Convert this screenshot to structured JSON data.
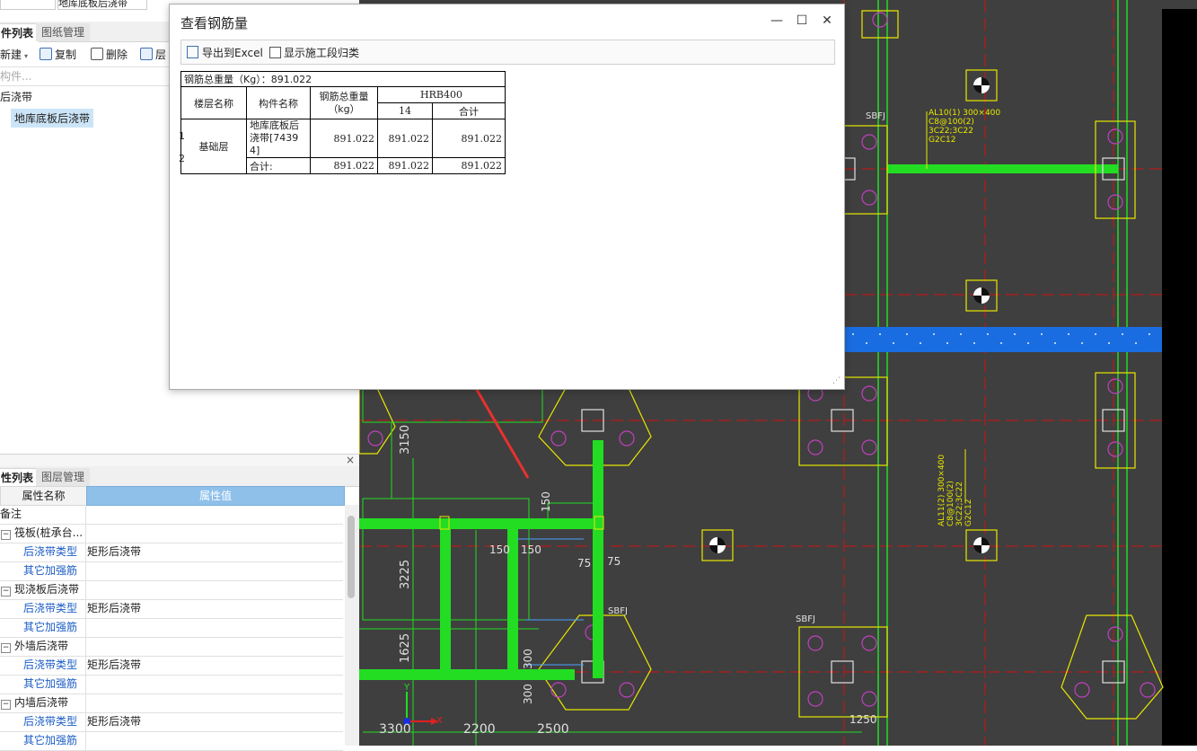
{
  "left_top": {
    "search_value": "地库底板后浇带",
    "tabs": [
      "件列表",
      "图纸管理"
    ],
    "toolbar": {
      "new": "新建",
      "copy": "复制",
      "delete": "删除",
      "layer": "层"
    },
    "search_placeholder": "构件...",
    "tree": {
      "group": "后浇带",
      "selected": "地库底板后浇带"
    }
  },
  "left_bottom": {
    "tabs": [
      "性列表",
      "图层管理"
    ],
    "close": "×",
    "header": {
      "name": "属性名称",
      "value": "属性值"
    },
    "rows": [
      {
        "name": "备注",
        "value": ""
      },
      {
        "name": "筏板(桩承台...",
        "value": "",
        "expander": "−"
      },
      {
        "name": "后浇带类型",
        "value": "矩形后浇带"
      },
      {
        "name": "其它加强筋",
        "value": ""
      },
      {
        "name": "现浇板后浇带",
        "value": "",
        "expander": "−"
      },
      {
        "name": "后浇带类型",
        "value": "矩形后浇带"
      },
      {
        "name": "其它加强筋",
        "value": ""
      },
      {
        "name": "外墙后浇带",
        "value": "",
        "expander": "−"
      },
      {
        "name": "后浇带类型",
        "value": "矩形后浇带"
      },
      {
        "name": "其它加强筋",
        "value": ""
      },
      {
        "name": "内墙后浇带",
        "value": "",
        "expander": "−"
      },
      {
        "name": "后浇带类型",
        "value": "矩形后浇带"
      },
      {
        "name": "其它加强筋",
        "value": ""
      }
    ]
  },
  "dialog": {
    "title": "查看钢筋量",
    "buttons": {
      "minimize": "—",
      "maximize": "☐",
      "close": "✕"
    },
    "export_label": "导出到Excel",
    "checkbox_label": "显示施工段归类",
    "table": {
      "total_label": "钢筋总重量（Kg）：891.022",
      "headers": {
        "floor": "楼层名称",
        "component": "构件名称",
        "total": "钢筋总重量\n（kg）",
        "grade": "HRB400",
        "dia": "14",
        "sum": "合计"
      },
      "row_nums": [
        "1",
        "2"
      ],
      "floor": "基础层",
      "component": "地库底板后浇带[74394]",
      "row1": {
        "total": "891.022",
        "d14": "891.022",
        "sum": "891.022"
      },
      "row2": {
        "label": "合计:",
        "total": "891.022",
        "d14": "891.022",
        "sum": "891.022"
      }
    }
  },
  "cad": {
    "dims": [
      "3150",
      "3225",
      "1625",
      "150",
      "150",
      "150",
      "75",
      "300",
      "75",
      "300",
      "3300",
      "2200",
      "2500",
      "1250"
    ],
    "labels": [
      "SBFJ",
      "SBFJ",
      "SBFJ",
      "SBFJ"
    ],
    "beam_note_1": [
      "AL10(1) 300×400",
      "C8@100(2)",
      "3C22;3C22",
      "G2C12"
    ],
    "beam_note_2": [
      "AL11(2) 300×400",
      "C8@100(2)",
      "3C22;3C22",
      "G2C12"
    ],
    "axis_x": "X",
    "axis_y": "Y"
  },
  "colors": {
    "cad_bg": "#3f3f3f",
    "green": "#22dd22",
    "yellow": "#e8e800",
    "red_grid": "#d01010",
    "magenta": "#c040c0",
    "blue_band": "#1a6de0",
    "header_blue": "#8fc0ea"
  }
}
